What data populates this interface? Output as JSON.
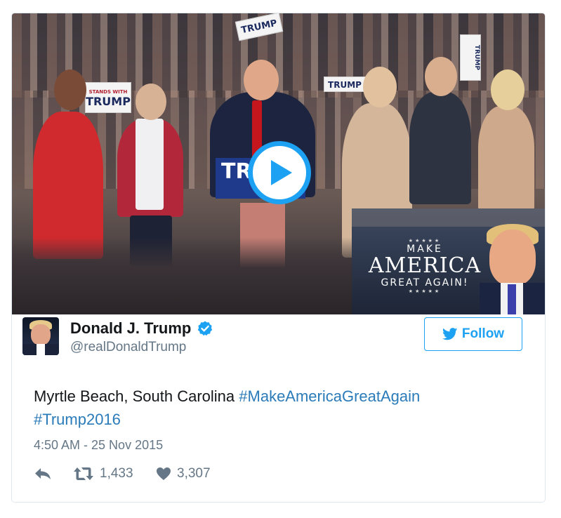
{
  "media": {
    "signs": {
      "stands_with": "STANDS WITH",
      "trump_sign": "TRUMP",
      "trump_top": "TRUMP",
      "trump_mid": "TRUMP",
      "trump_vertical": "TRUMP"
    },
    "podium_sign": "TR",
    "inset": {
      "stars_top": "★★★★★",
      "line1": "MAKE",
      "line2": "AMERICA",
      "line3": "GREAT AGAIN!",
      "stars_bottom": "★★★★★"
    },
    "play_icon": "play-icon"
  },
  "user": {
    "name": "Donald J. Trump",
    "handle": "@realDonaldTrump",
    "verified_icon": "verified-badge-icon"
  },
  "follow_button": {
    "label": "Follow",
    "icon": "twitter-bird-icon"
  },
  "tweet": {
    "text_plain": "Myrtle Beach, South Carolina ",
    "hashtag1": "#MakeAmericaGreatAgain",
    "hashtag2": "#Trump2016",
    "timestamp": "4:50 AM - 25 Nov 2015"
  },
  "actions": {
    "reply_icon": "reply-icon",
    "retweet_icon": "retweet-icon",
    "retweet_count": "1,433",
    "like_icon": "heart-icon",
    "like_count": "3,307"
  },
  "colors": {
    "accent": "#1da1f2",
    "hashtag": "#2b7bb9",
    "secondary_text": "#657786",
    "border": "#e1e8ed"
  }
}
